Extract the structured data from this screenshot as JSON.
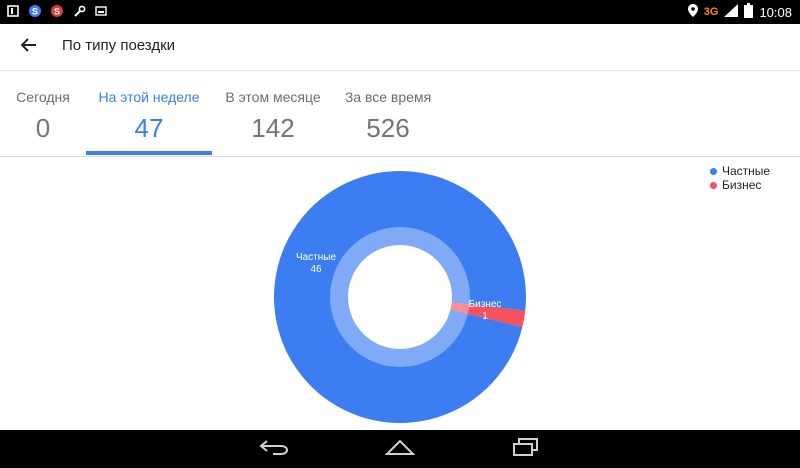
{
  "status_bar": {
    "network": "3G",
    "time": "10:08",
    "icons": [
      "notification-icon",
      "s-app-icon",
      "s-app-red-icon",
      "wrench-icon",
      "screenshot-icon",
      "location-icon",
      "signal-icon",
      "battery-icon"
    ]
  },
  "header": {
    "back_icon": "arrow-back-icon",
    "title": "По типу поездки"
  },
  "tabs": [
    {
      "label": "Сегодня",
      "value": "0"
    },
    {
      "label": "На этой неделе",
      "value": "47",
      "active": true
    },
    {
      "label": "В этом месяце",
      "value": "142"
    },
    {
      "label": "За все время",
      "value": "526"
    }
  ],
  "chart_data": {
    "type": "pie",
    "style": "donut",
    "categories": [
      "Частные",
      "Бизнес"
    ],
    "values": [
      46,
      1
    ],
    "colors": [
      "#3d7df2",
      "#f5515f"
    ],
    "legend": {
      "placement": "top-right",
      "entries": [
        "Частные",
        "Бизнес"
      ]
    },
    "slice_labels": [
      {
        "name": "Частные",
        "value": "46"
      },
      {
        "name": "Бизнес",
        "value": "1"
      }
    ]
  },
  "nav_bar": {
    "icons": [
      "back-nav-icon",
      "home-nav-icon",
      "recents-nav-icon"
    ]
  }
}
